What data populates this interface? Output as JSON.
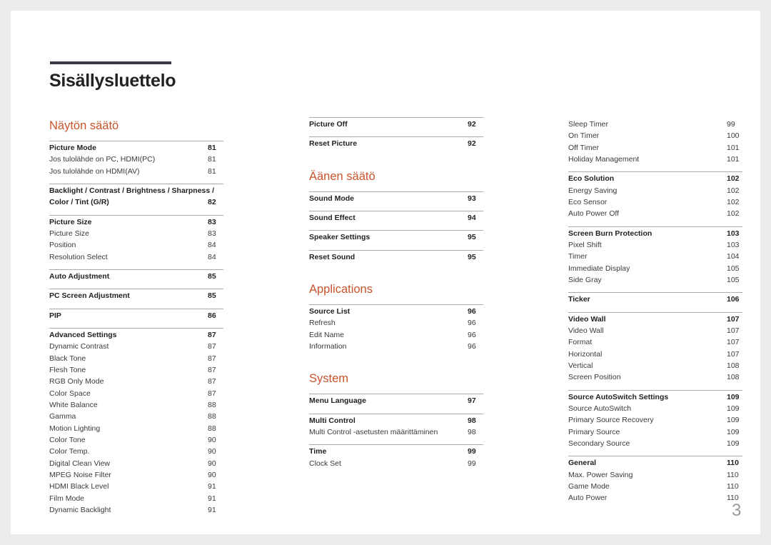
{
  "title": "Sisällysluettelo",
  "page_number": "3",
  "accent_color": "#c9542c",
  "columns": [
    [
      {
        "heading": "Näytön säätö",
        "groups": [
          {
            "title": "Picture Mode",
            "page": "81",
            "items": [
              [
                "Jos tulolähde on PC, HDMI(PC)",
                "81"
              ],
              [
                "Jos tulolähde on HDMI(AV)",
                "81"
              ]
            ]
          },
          {
            "title_lines": [
              "Backlight / Contrast / Brightness / Sharpness /"
            ],
            "title": "Color / Tint (G/R)",
            "page": "82",
            "items": []
          },
          {
            "title": "Picture Size",
            "page": "83",
            "items": [
              [
                "Picture Size",
                "83"
              ],
              [
                "Position",
                "84"
              ],
              [
                "Resolution Select",
                "84"
              ]
            ]
          },
          {
            "title": "Auto Adjustment",
            "page": "85",
            "items": []
          },
          {
            "title": "PC Screen Adjustment",
            "page": "85",
            "items": []
          },
          {
            "title": "PIP",
            "page": "86",
            "items": []
          },
          {
            "title": "Advanced Settings",
            "page": "87",
            "items": [
              [
                "Dynamic Contrast",
                "87"
              ],
              [
                "Black Tone",
                "87"
              ],
              [
                "Flesh Tone",
                "87"
              ],
              [
                "RGB Only Mode",
                "87"
              ],
              [
                "Color Space",
                "87"
              ],
              [
                "White Balance",
                "88"
              ],
              [
                "Gamma",
                "88"
              ],
              [
                "Motion Lighting",
                "88"
              ],
              [
                "Color Tone",
                "90"
              ],
              [
                "Color Temp.",
                "90"
              ],
              [
                "Digital Clean View",
                "90"
              ],
              [
                "MPEG Noise Filter",
                "90"
              ],
              [
                "HDMI Black Level",
                "91"
              ],
              [
                "Film Mode",
                "91"
              ],
              [
                "Dynamic Backlight",
                "91"
              ]
            ]
          }
        ]
      }
    ],
    [
      {
        "heading": "",
        "groups": [
          {
            "title": "Picture Off",
            "page": "92",
            "items": []
          },
          {
            "title": "Reset Picture",
            "page": "92",
            "items": []
          }
        ]
      },
      {
        "heading": "Äänen säätö",
        "groups": [
          {
            "title": "Sound Mode",
            "page": "93",
            "items": []
          },
          {
            "title": "Sound Effect",
            "page": "94",
            "items": []
          },
          {
            "title": "Speaker Settings",
            "page": "95",
            "items": []
          },
          {
            "title": "Reset Sound",
            "page": "95",
            "items": []
          }
        ]
      },
      {
        "heading": "Applications",
        "groups": [
          {
            "title": "Source List",
            "page": "96",
            "items": [
              [
                "Refresh",
                "96"
              ],
              [
                "Edit Name",
                "96"
              ],
              [
                "Information",
                "96"
              ]
            ]
          }
        ]
      },
      {
        "heading": "System",
        "groups": [
          {
            "title": "Menu Language",
            "page": "97",
            "items": []
          },
          {
            "title": "Multi Control",
            "page": "98",
            "items": [
              [
                "Multi Control -asetusten määrittäminen",
                "98"
              ]
            ]
          },
          {
            "title": "Time",
            "page": "99",
            "items": [
              [
                "Clock Set",
                "99"
              ]
            ]
          }
        ]
      }
    ],
    [
      {
        "heading": "",
        "groups": [
          {
            "norule": true,
            "items": [
              [
                "Sleep Timer",
                "99"
              ],
              [
                "On Timer",
                "100"
              ],
              [
                "Off Timer",
                "101"
              ],
              [
                "Holiday Management",
                "101"
              ]
            ]
          },
          {
            "title": "Eco Solution",
            "page": "102",
            "items": [
              [
                "Energy Saving",
                "102"
              ],
              [
                "Eco Sensor",
                "102"
              ],
              [
                "Auto Power Off",
                "102"
              ]
            ]
          },
          {
            "title": "Screen Burn Protection",
            "page": "103",
            "items": [
              [
                "Pixel Shift",
                "103"
              ],
              [
                "Timer",
                "104"
              ],
              [
                "Immediate Display",
                "105"
              ],
              [
                "Side Gray",
                "105"
              ]
            ]
          },
          {
            "title": "Ticker",
            "page": "106",
            "items": []
          },
          {
            "title": "Video Wall",
            "page": "107",
            "items": [
              [
                "Video Wall",
                "107"
              ],
              [
                "Format",
                "107"
              ],
              [
                "Horizontal",
                "107"
              ],
              [
                "Vertical",
                "108"
              ],
              [
                "Screen Position",
                "108"
              ]
            ]
          },
          {
            "title": "Source AutoSwitch Settings",
            "page": "109",
            "items": [
              [
                "Source AutoSwitch",
                "109"
              ],
              [
                "Primary Source Recovery",
                "109"
              ],
              [
                "Primary Source",
                "109"
              ],
              [
                "Secondary Source",
                "109"
              ]
            ]
          },
          {
            "title": "General",
            "page": "110",
            "items": [
              [
                "Max. Power Saving",
                "110"
              ],
              [
                "Game Mode",
                "110"
              ],
              [
                "Auto Power",
                "110"
              ]
            ]
          }
        ]
      }
    ]
  ]
}
